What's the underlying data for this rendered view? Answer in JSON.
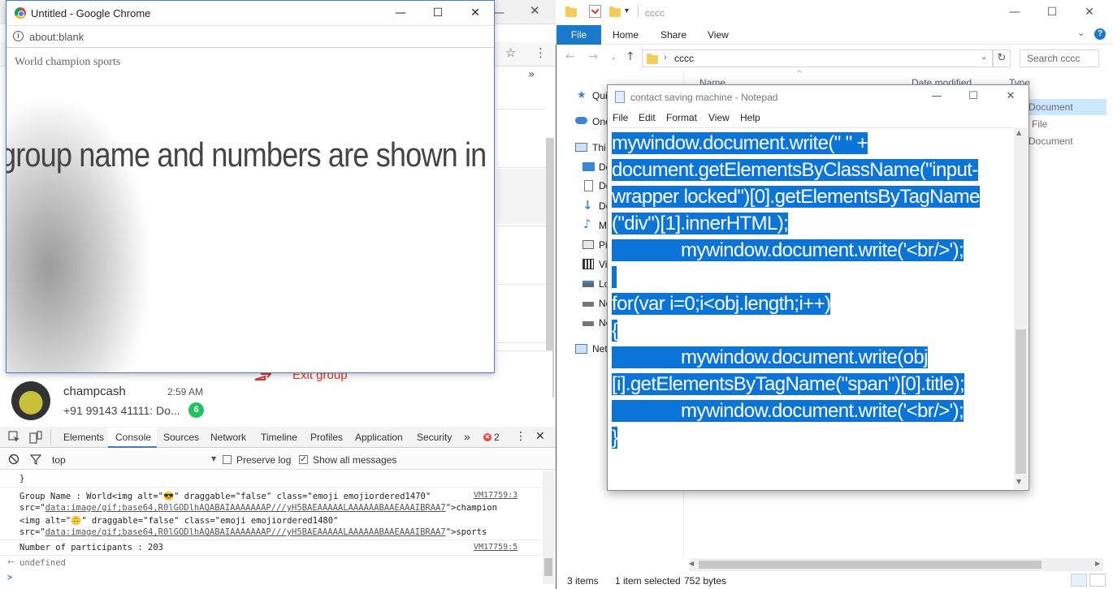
{
  "chrome_popup": {
    "title": "Untitled - Google Chrome",
    "url": "about:blank",
    "ghost_text": "World champion sports",
    "overlay_caption": "group name and numbers are shown in new windows"
  },
  "whatsapp": {
    "chat": {
      "name": "champcash",
      "time": "2:59 AM",
      "preview": "+91 99143 41111: Do...",
      "unread": "6"
    },
    "exit_group_label": "Exit group"
  },
  "devtools": {
    "tabs": [
      "Elements",
      "Console",
      "Sources",
      "Network",
      "Timeline",
      "Profiles",
      "Application",
      "Security"
    ],
    "active_tab": "Console",
    "more_tabs": "»",
    "error_count": "2",
    "context": "top",
    "preserve_log_label": "Preserve log",
    "show_all_label": "Show all messages",
    "console": {
      "line_brace": "}",
      "group_line1": "Group Name : World<img alt=\"😎\" draggable=\"false\" class=\"emoji emojiordered1470\"",
      "group_src1_prefix": "src=\"",
      "group_src1_link": "data:image/gif;base64,R0lGODlhAQABAIAAAAAAAP///yH5BAEAAAAALAAAAAABAAEAAAIBRAA7",
      "group_src1_suffix": "\">champion",
      "group_line3": "<img alt=\"🙃\" draggable=\"false\" class=\"emoji emojiordered1480\"",
      "group_src2_prefix": "src=\"",
      "group_src2_link": "data:image/gif;base64,R0lGODlhAQABAIAAAAAAAP///yH5BAEAAAAALAAAAAABAAEAAAIBRAA7",
      "group_src2_suffix": "\">sports",
      "group_ref": "VM17759:3",
      "participants_line": "Number of participants : 203",
      "participants_ref": "VM17759:5",
      "undefined_line": "undefined",
      "prompt": ">"
    }
  },
  "explorer": {
    "title": "cccc",
    "ribbon_tabs": [
      "File",
      "Home",
      "Share",
      "View"
    ],
    "address": "cccc",
    "search_placeholder": "Search cccc",
    "columns": [
      "Name",
      "Date modified",
      "Type"
    ],
    "nav_items": [
      {
        "label": "Quick access",
        "icon": "star-icon"
      },
      {
        "label": "OneDrive",
        "icon": "cloud-icon"
      },
      {
        "label": "This PC",
        "icon": "computer-icon"
      },
      {
        "label": "Desktop",
        "icon": "desktop-icon"
      },
      {
        "label": "Documents",
        "icon": "document-icon"
      },
      {
        "label": "Downloads",
        "icon": "download-icon"
      },
      {
        "label": "Music",
        "icon": "music-icon"
      },
      {
        "label": "Pictures",
        "icon": "picture-icon"
      },
      {
        "label": "Videos",
        "icon": "video-icon"
      },
      {
        "label": "Local Disk",
        "icon": "disk-icon"
      },
      {
        "label": "New Volume",
        "icon": "drive-icon"
      },
      {
        "label": "New Volume",
        "icon": "drive-icon"
      },
      {
        "label": "Network",
        "icon": "network-icon"
      }
    ],
    "nav_visible": [
      "Qui",
      "One",
      "Thi",
      "De",
      "Do",
      "Do",
      "M",
      "Pi",
      "Vi",
      "Lo",
      "Ne",
      "Ne",
      "Net"
    ],
    "file_types": [
      "Document",
      "File",
      "Document"
    ],
    "status": {
      "items": "3 items",
      "selected": "1 item selected",
      "size": "752 bytes"
    }
  },
  "notepad": {
    "title": "contact saving machine - Notepad",
    "menu": [
      "File",
      "Edit",
      "Format",
      "View",
      "Help"
    ],
    "lines": [
      "mywindow.document.write(\" \" +",
      "document.getElementsByClassName(\"input-",
      "wrapper locked\")[0].getElementsByTagName",
      "(\"div\")[1].innerHTML);",
      "              mywindow.document.write('<br/>');",
      " ",
      "for(var i=0;i<obj.length;i++)",
      "{",
      "              mywindow.document.write(obj",
      "[i].getElementsByTagName(\"span\")[0].title);",
      "              mywindow.document.write('<br/>');",
      "}"
    ]
  }
}
